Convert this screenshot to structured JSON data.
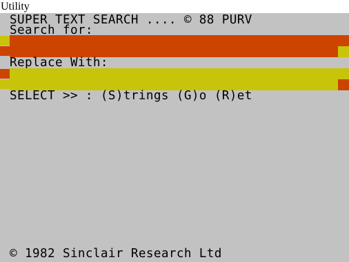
{
  "window": {
    "caption": "Utility"
  },
  "screen": {
    "header_line": "SUPER TEXT SEARCH .... © 88 PURV",
    "search_label": "Search for:",
    "replace_label": "Replace With:",
    "select_line": "SELECT >> : (S)trings (G)o (R)et",
    "footer_line": "© 1982 Sinclair Research Ltd",
    "search_field_value": "",
    "replace_field_value": ""
  },
  "colors": {
    "screen_bg": "#c2c2c2",
    "search_field": "#cc4400",
    "search_markers": "#c8c40a",
    "replace_field": "#c8c40a",
    "replace_markers": "#cc4400"
  }
}
